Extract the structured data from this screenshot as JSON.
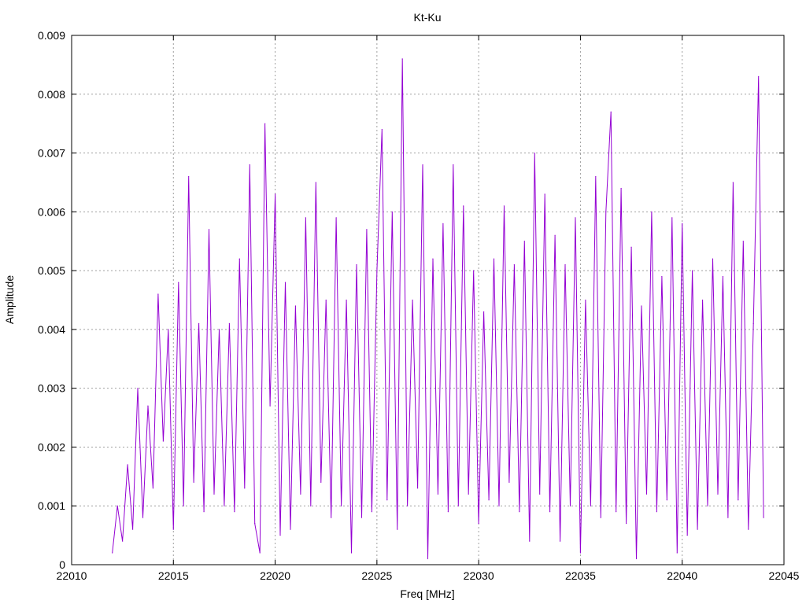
{
  "chart_data": {
    "type": "line",
    "title": "Kt-Ku",
    "xlabel": "Freq [MHz]",
    "ylabel": "Amplitude",
    "xlim": [
      22010,
      22045
    ],
    "ylim": [
      0,
      0.009
    ],
    "xticks": [
      "22010",
      "22015",
      "22020",
      "22025",
      "22030",
      "22035",
      "22040",
      "22045"
    ],
    "yticks": [
      "0",
      "0.001",
      "0.002",
      "0.003",
      "0.004",
      "0.005",
      "0.006",
      "0.007",
      "0.008",
      "0.009"
    ],
    "grid": true,
    "legend": "none",
    "series": [
      {
        "name": "Kt-Ku",
        "color": "#9400d3",
        "x_start": 22012,
        "x_step": 0.25,
        "values": [
          0.0002,
          0.001,
          0.0004,
          0.0017,
          0.0006,
          0.003,
          0.0008,
          0.0027,
          0.0013,
          0.0046,
          0.0021,
          0.004,
          0.0006,
          0.0048,
          0.001,
          0.0066,
          0.0014,
          0.0041,
          0.0009,
          0.0057,
          0.0012,
          0.004,
          0.001,
          0.0041,
          0.0009,
          0.0052,
          0.0013,
          0.0068,
          0.0007,
          0.0002,
          0.0075,
          0.0027,
          0.0063,
          0.0005,
          0.0048,
          0.0006,
          0.0044,
          0.0012,
          0.0059,
          0.001,
          0.0065,
          0.0014,
          0.0045,
          0.0008,
          0.0059,
          0.001,
          0.0045,
          0.0002,
          0.0051,
          0.0008,
          0.0057,
          0.0009,
          0.005,
          0.0074,
          0.0011,
          0.006,
          0.0006,
          0.0086,
          0.001,
          0.0045,
          0.0013,
          0.0068,
          0.0001,
          0.0052,
          0.0012,
          0.0058,
          0.0009,
          0.0068,
          0.001,
          0.0061,
          0.0012,
          0.005,
          0.0007,
          0.0043,
          0.0011,
          0.0052,
          0.001,
          0.0061,
          0.0014,
          0.0051,
          0.0009,
          0.0055,
          0.0004,
          0.007,
          0.0012,
          0.0063,
          0.0009,
          0.0056,
          0.0004,
          0.0051,
          0.001,
          0.0059,
          0.0002,
          0.0045,
          0.001,
          0.0066,
          0.0008,
          0.006,
          0.0077,
          0.0009,
          0.0064,
          0.0007,
          0.0054,
          0.0001,
          0.0044,
          0.0012,
          0.006,
          0.0009,
          0.0049,
          0.0011,
          0.0059,
          0.0002,
          0.0058,
          0.0005,
          0.005,
          0.0006,
          0.0045,
          0.001,
          0.0052,
          0.0012,
          0.0049,
          0.0008,
          0.0065,
          0.0011,
          0.0055,
          0.0006,
          0.0041,
          0.0083,
          0.0008
        ]
      }
    ]
  }
}
